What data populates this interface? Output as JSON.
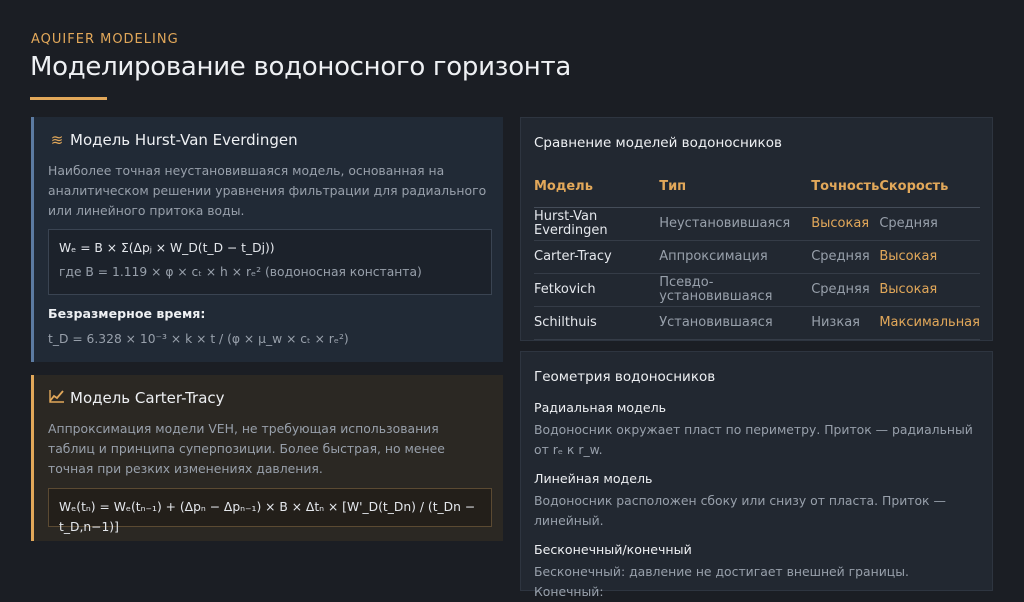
{
  "header": {
    "eyebrow": "AQUIFER MODELING",
    "title": "Моделирование водоносного горизонта"
  },
  "hurst_card": {
    "icon": "waves-icon",
    "title": "Модель Hurst-Van Everdingen",
    "description": "Наиболее точная неустановившаяся модель, основанная на аналитическом решении уравнения фильтрации для радиального или линейного притока воды.",
    "formula_main": "Wₑ = B × Σ(Δpⱼ × W_D(t_D − t_Dj))",
    "formula_note": "где B = 1.119 × φ × cₜ × h × rₑ² (водоносная константа)",
    "dimensionless_title": "Безразмерное время:",
    "dimensionless_formula": "t_D = 6.328 × 10⁻³ × k × t / (φ × μ_w × cₜ × rₑ²)"
  },
  "carter_card": {
    "icon": "trend-icon",
    "title": "Модель Carter-Tracy",
    "description": "Аппроксимация модели VEH, не требующая использования таблиц и принципа суперпозиции. Более быстрая, но менее точная при резких изменениях давления.",
    "formula": "Wₑ(tₙ) = Wₑ(tₙ₋₁) + (Δpₙ − Δpₙ₋₁) × B × Δtₙ × [W'_D(t_Dn) / (t_Dn − t_D,n−1)]"
  },
  "comparison": {
    "title": "Сравнение моделей водоносников",
    "headers": [
      "Модель",
      "Тип",
      "Точность",
      "Скорость"
    ],
    "rows": [
      {
        "model": "Hurst-Van Everdingen",
        "type": "Неустановившаяся",
        "accuracy": "Высокая",
        "speed": "Средняя",
        "accuracy_hi": true,
        "speed_hi": false
      },
      {
        "model": "Carter-Tracy",
        "type": "Аппроксимация",
        "accuracy": "Средняя",
        "speed": "Высокая",
        "accuracy_hi": false,
        "speed_hi": true
      },
      {
        "model": "Fetkovich",
        "type": "Псевдо-установившаяся",
        "accuracy": "Средняя",
        "speed": "Высокая",
        "accuracy_hi": false,
        "speed_hi": true
      },
      {
        "model": "Schilthuis",
        "type": "Установившаяся",
        "accuracy": "Низкая",
        "speed": "Максимальная",
        "accuracy_hi": false,
        "speed_hi": true
      }
    ]
  },
  "geometry": {
    "title": "Геометрия водоносников",
    "sections": [
      {
        "title": "Радиальная модель",
        "text": "Водоносник окружает пласт по периметру. Приток — радиальный от rₑ к r_w."
      },
      {
        "title": "Линейная модель",
        "text": "Водоносник расположен сбоку или снизу от пласта. Приток — линейный."
      },
      {
        "title": "Бесконечный/конечный",
        "text": "Бесконечный: давление не достигает внешней границы. Конечный:"
      }
    ]
  },
  "colors": {
    "accent": "#e2a85a",
    "blue_accent": "#5c7ba2",
    "background": "#1b1e24"
  }
}
